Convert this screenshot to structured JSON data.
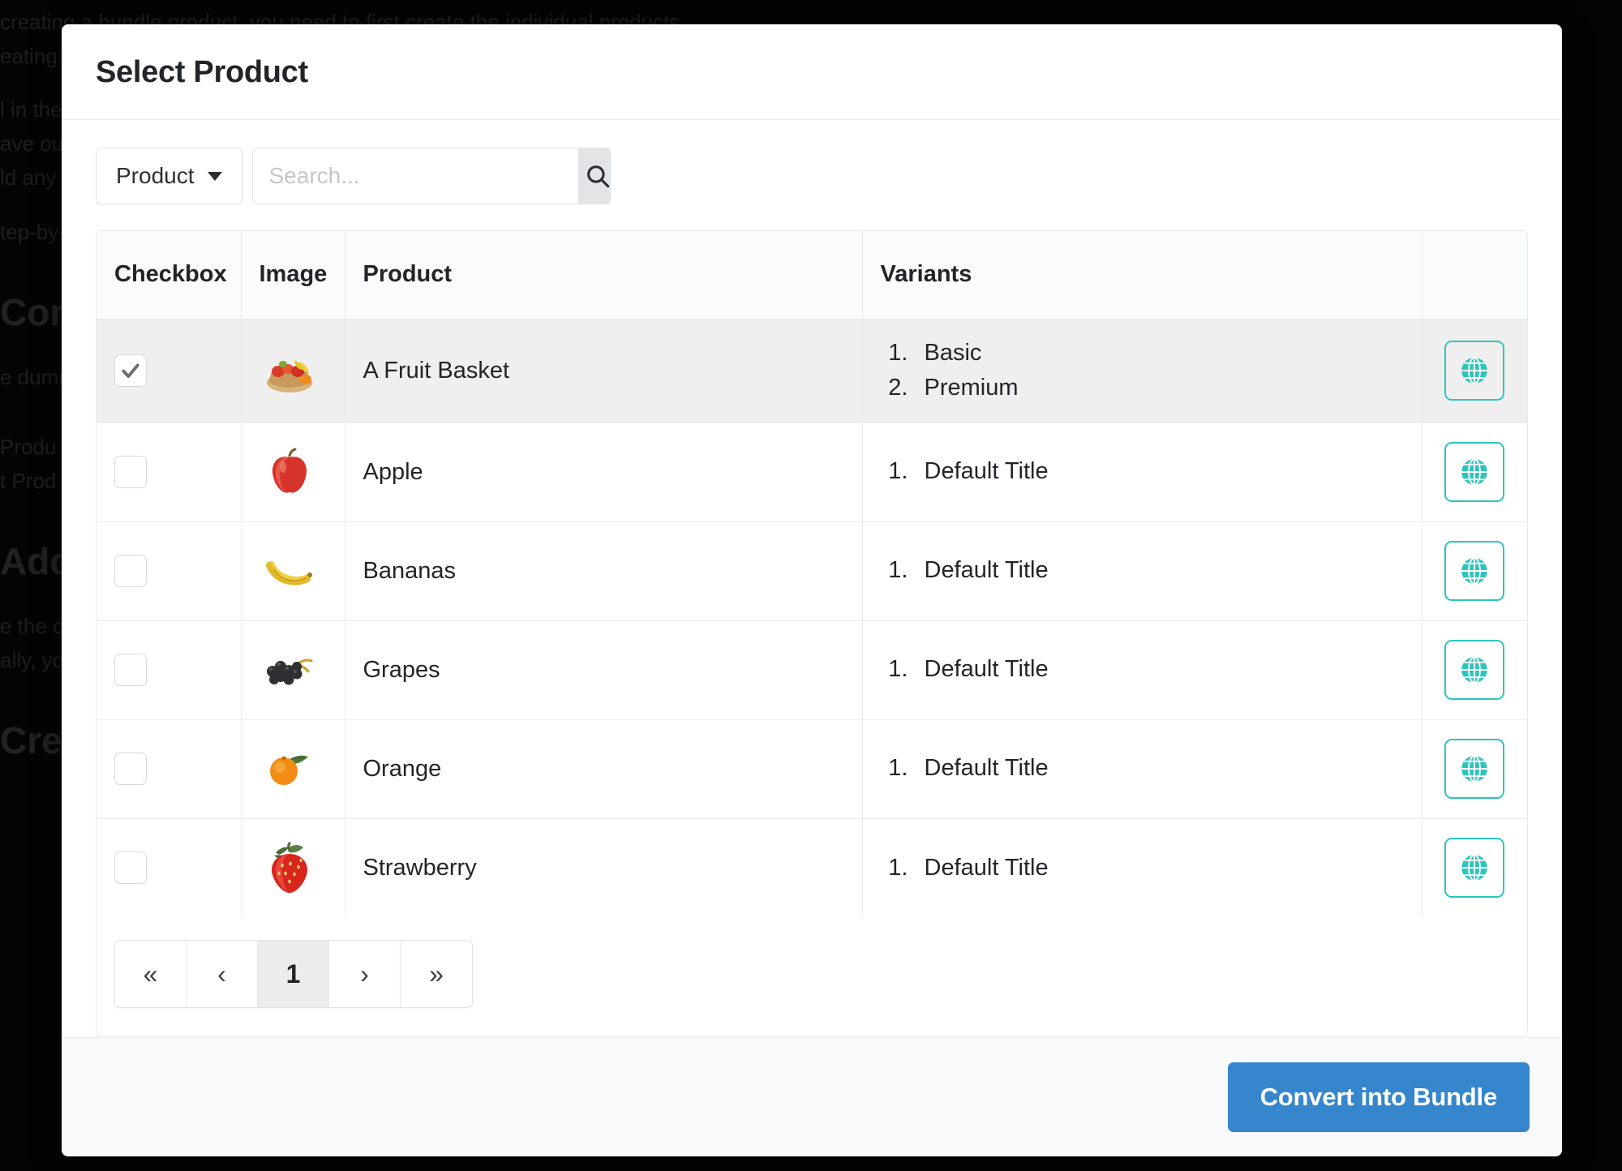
{
  "background": {
    "lines": [
      "creating a bundle product, you need to first create the individual products.",
      "eating the individual products, you can then create the bundle product.",
      "l in the details for the bundle product, such as the name, description and price.",
      "ave our products ready, we can now create the bundle product.",
      "ld any of the individual products to the bundle product.",
      "tep-by-step guide on how to create a bundle product."
    ],
    "headings": [
      "Con",
      "Add",
      "Cre"
    ],
    "mid_lines": [
      "e dummy products that we will use for the bundle product.",
      " Produ",
      "t Prod"
    ],
    "lower_lines": [
      "e the o",
      "ally, yo"
    ]
  },
  "modal": {
    "title": "Select Product",
    "filter": {
      "label": "Product",
      "icon": "chevron-down-icon"
    },
    "search": {
      "value": "",
      "placeholder": "Search...",
      "button_icon": "search-icon"
    },
    "table": {
      "headers": {
        "checkbox": "Checkbox",
        "image": "Image",
        "product": "Product",
        "variants": "Variants",
        "action": ""
      },
      "rows": [
        {
          "checked": true,
          "selected": true,
          "image": "fruit-basket-thumbnail",
          "product": "A Fruit Basket",
          "variants": [
            "Basic",
            "Premium"
          ],
          "action_icon": "globe-icon"
        },
        {
          "checked": false,
          "selected": false,
          "image": "apple-thumbnail",
          "product": "Apple",
          "variants": [
            "Default Title"
          ],
          "action_icon": "globe-icon"
        },
        {
          "checked": false,
          "selected": false,
          "image": "banana-thumbnail",
          "product": "Bananas",
          "variants": [
            "Default Title"
          ],
          "action_icon": "globe-icon"
        },
        {
          "checked": false,
          "selected": false,
          "image": "grapes-thumbnail",
          "product": "Grapes",
          "variants": [
            "Default Title"
          ],
          "action_icon": "globe-icon"
        },
        {
          "checked": false,
          "selected": false,
          "image": "orange-thumbnail",
          "product": "Orange",
          "variants": [
            "Default Title"
          ],
          "action_icon": "globe-icon"
        },
        {
          "checked": false,
          "selected": false,
          "image": "strawberry-thumbnail",
          "product": "Strawberry",
          "variants": [
            "Default Title"
          ],
          "action_icon": "globe-icon"
        }
      ]
    },
    "pagination": {
      "first": "«",
      "prev": "‹",
      "pages": [
        "1"
      ],
      "current_page": "1",
      "next": "›",
      "last": "»"
    },
    "footer": {
      "primary_button": "Convert into Bundle"
    }
  },
  "colors": {
    "primary_button": "#3586cd",
    "action_outline": "#2cc5bd",
    "selected_row": "#efefef",
    "header_bg": "#fafbfb"
  }
}
